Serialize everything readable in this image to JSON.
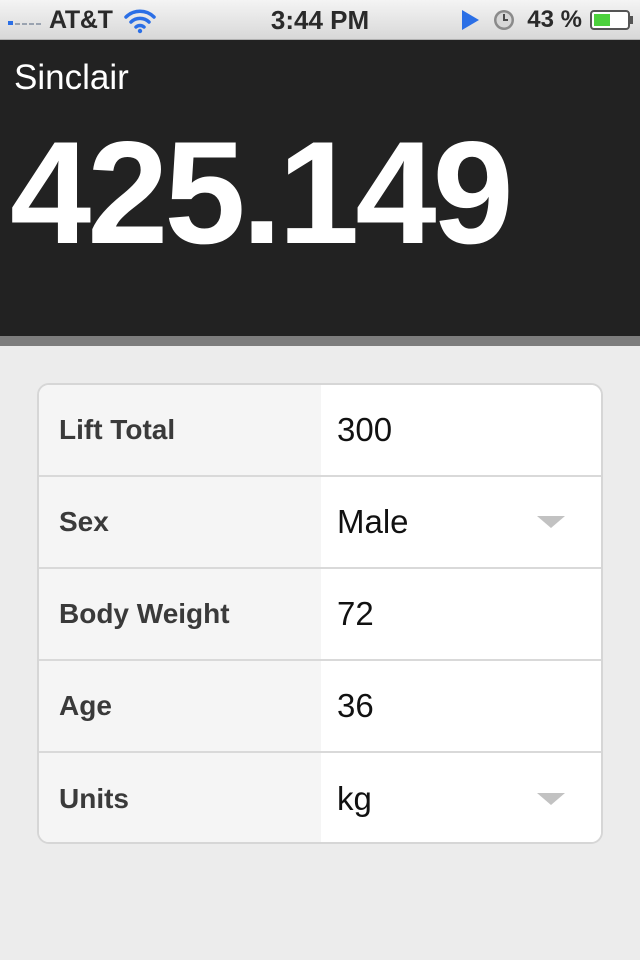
{
  "status_bar": {
    "carrier": "AT&T",
    "time": "3:44 PM",
    "battery_percent": "43 %",
    "signal_icon": "signal-bars-icon",
    "wifi_icon": "wifi-icon",
    "location_icon": "location-arrow-icon",
    "alarm_icon": "clock-icon",
    "battery_icon": "battery-icon",
    "accent_color": "#2b6fe6",
    "battery_color": "#4cd13c"
  },
  "result": {
    "label": "Sinclair",
    "value": "425.149",
    "background": "#222222"
  },
  "form": {
    "rows": [
      {
        "label": "Lift Total",
        "value": "300",
        "type": "input"
      },
      {
        "label": "Sex",
        "value": "Male",
        "type": "select",
        "arrow_icon": "dropdown-arrow-icon"
      },
      {
        "label": "Body Weight",
        "value": "72",
        "type": "input"
      },
      {
        "label": "Age",
        "value": "36",
        "type": "input"
      },
      {
        "label": "Units",
        "value": "kg",
        "type": "select",
        "arrow_icon": "dropdown-arrow-icon"
      }
    ]
  }
}
